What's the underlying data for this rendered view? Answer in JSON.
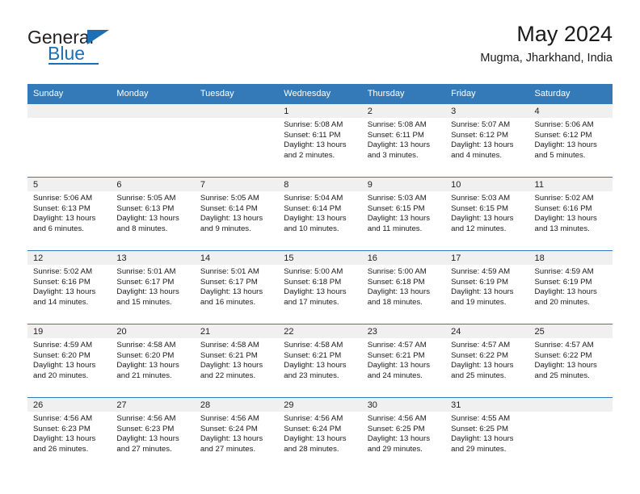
{
  "logo": {
    "primary_text": "General",
    "secondary_text": "Blue",
    "primary_color": "#231f20",
    "accent_color": "#1c6fb5",
    "triangle_icon": "triangle-icon"
  },
  "header": {
    "title": "May 2024",
    "subtitle": "Mugma, Jharkhand, India"
  },
  "calendar": {
    "header_bg": "#3479b8",
    "day_band_bg": "#f0f0f0",
    "weekdays": [
      "Sunday",
      "Monday",
      "Tuesday",
      "Wednesday",
      "Thursday",
      "Friday",
      "Saturday"
    ],
    "weeks": [
      [
        {
          "day": "",
          "line1": "",
          "line2": "",
          "line3": "",
          "line4": ""
        },
        {
          "day": "",
          "line1": "",
          "line2": "",
          "line3": "",
          "line4": ""
        },
        {
          "day": "",
          "line1": "",
          "line2": "",
          "line3": "",
          "line4": ""
        },
        {
          "day": "1",
          "line1": "Sunrise: 5:08 AM",
          "line2": "Sunset: 6:11 PM",
          "line3": "Daylight: 13 hours",
          "line4": "and 2 minutes."
        },
        {
          "day": "2",
          "line1": "Sunrise: 5:08 AM",
          "line2": "Sunset: 6:11 PM",
          "line3": "Daylight: 13 hours",
          "line4": "and 3 minutes."
        },
        {
          "day": "3",
          "line1": "Sunrise: 5:07 AM",
          "line2": "Sunset: 6:12 PM",
          "line3": "Daylight: 13 hours",
          "line4": "and 4 minutes."
        },
        {
          "day": "4",
          "line1": "Sunrise: 5:06 AM",
          "line2": "Sunset: 6:12 PM",
          "line3": "Daylight: 13 hours",
          "line4": "and 5 minutes."
        }
      ],
      [
        {
          "day": "5",
          "line1": "Sunrise: 5:06 AM",
          "line2": "Sunset: 6:13 PM",
          "line3": "Daylight: 13 hours",
          "line4": "and 6 minutes."
        },
        {
          "day": "6",
          "line1": "Sunrise: 5:05 AM",
          "line2": "Sunset: 6:13 PM",
          "line3": "Daylight: 13 hours",
          "line4": "and 8 minutes."
        },
        {
          "day": "7",
          "line1": "Sunrise: 5:05 AM",
          "line2": "Sunset: 6:14 PM",
          "line3": "Daylight: 13 hours",
          "line4": "and 9 minutes."
        },
        {
          "day": "8",
          "line1": "Sunrise: 5:04 AM",
          "line2": "Sunset: 6:14 PM",
          "line3": "Daylight: 13 hours",
          "line4": "and 10 minutes."
        },
        {
          "day": "9",
          "line1": "Sunrise: 5:03 AM",
          "line2": "Sunset: 6:15 PM",
          "line3": "Daylight: 13 hours",
          "line4": "and 11 minutes."
        },
        {
          "day": "10",
          "line1": "Sunrise: 5:03 AM",
          "line2": "Sunset: 6:15 PM",
          "line3": "Daylight: 13 hours",
          "line4": "and 12 minutes."
        },
        {
          "day": "11",
          "line1": "Sunrise: 5:02 AM",
          "line2": "Sunset: 6:16 PM",
          "line3": "Daylight: 13 hours",
          "line4": "and 13 minutes."
        }
      ],
      [
        {
          "day": "12",
          "line1": "Sunrise: 5:02 AM",
          "line2": "Sunset: 6:16 PM",
          "line3": "Daylight: 13 hours",
          "line4": "and 14 minutes."
        },
        {
          "day": "13",
          "line1": "Sunrise: 5:01 AM",
          "line2": "Sunset: 6:17 PM",
          "line3": "Daylight: 13 hours",
          "line4": "and 15 minutes."
        },
        {
          "day": "14",
          "line1": "Sunrise: 5:01 AM",
          "line2": "Sunset: 6:17 PM",
          "line3": "Daylight: 13 hours",
          "line4": "and 16 minutes."
        },
        {
          "day": "15",
          "line1": "Sunrise: 5:00 AM",
          "line2": "Sunset: 6:18 PM",
          "line3": "Daylight: 13 hours",
          "line4": "and 17 minutes."
        },
        {
          "day": "16",
          "line1": "Sunrise: 5:00 AM",
          "line2": "Sunset: 6:18 PM",
          "line3": "Daylight: 13 hours",
          "line4": "and 18 minutes."
        },
        {
          "day": "17",
          "line1": "Sunrise: 4:59 AM",
          "line2": "Sunset: 6:19 PM",
          "line3": "Daylight: 13 hours",
          "line4": "and 19 minutes."
        },
        {
          "day": "18",
          "line1": "Sunrise: 4:59 AM",
          "line2": "Sunset: 6:19 PM",
          "line3": "Daylight: 13 hours",
          "line4": "and 20 minutes."
        }
      ],
      [
        {
          "day": "19",
          "line1": "Sunrise: 4:59 AM",
          "line2": "Sunset: 6:20 PM",
          "line3": "Daylight: 13 hours",
          "line4": "and 20 minutes."
        },
        {
          "day": "20",
          "line1": "Sunrise: 4:58 AM",
          "line2": "Sunset: 6:20 PM",
          "line3": "Daylight: 13 hours",
          "line4": "and 21 minutes."
        },
        {
          "day": "21",
          "line1": "Sunrise: 4:58 AM",
          "line2": "Sunset: 6:21 PM",
          "line3": "Daylight: 13 hours",
          "line4": "and 22 minutes."
        },
        {
          "day": "22",
          "line1": "Sunrise: 4:58 AM",
          "line2": "Sunset: 6:21 PM",
          "line3": "Daylight: 13 hours",
          "line4": "and 23 minutes."
        },
        {
          "day": "23",
          "line1": "Sunrise: 4:57 AM",
          "line2": "Sunset: 6:21 PM",
          "line3": "Daylight: 13 hours",
          "line4": "and 24 minutes."
        },
        {
          "day": "24",
          "line1": "Sunrise: 4:57 AM",
          "line2": "Sunset: 6:22 PM",
          "line3": "Daylight: 13 hours",
          "line4": "and 25 minutes."
        },
        {
          "day": "25",
          "line1": "Sunrise: 4:57 AM",
          "line2": "Sunset: 6:22 PM",
          "line3": "Daylight: 13 hours",
          "line4": "and 25 minutes."
        }
      ],
      [
        {
          "day": "26",
          "line1": "Sunrise: 4:56 AM",
          "line2": "Sunset: 6:23 PM",
          "line3": "Daylight: 13 hours",
          "line4": "and 26 minutes."
        },
        {
          "day": "27",
          "line1": "Sunrise: 4:56 AM",
          "line2": "Sunset: 6:23 PM",
          "line3": "Daylight: 13 hours",
          "line4": "and 27 minutes."
        },
        {
          "day": "28",
          "line1": "Sunrise: 4:56 AM",
          "line2": "Sunset: 6:24 PM",
          "line3": "Daylight: 13 hours",
          "line4": "and 27 minutes."
        },
        {
          "day": "29",
          "line1": "Sunrise: 4:56 AM",
          "line2": "Sunset: 6:24 PM",
          "line3": "Daylight: 13 hours",
          "line4": "and 28 minutes."
        },
        {
          "day": "30",
          "line1": "Sunrise: 4:56 AM",
          "line2": "Sunset: 6:25 PM",
          "line3": "Daylight: 13 hours",
          "line4": "and 29 minutes."
        },
        {
          "day": "31",
          "line1": "Sunrise: 4:55 AM",
          "line2": "Sunset: 6:25 PM",
          "line3": "Daylight: 13 hours",
          "line4": "and 29 minutes."
        },
        {
          "day": "",
          "line1": "",
          "line2": "",
          "line3": "",
          "line4": ""
        }
      ]
    ]
  }
}
